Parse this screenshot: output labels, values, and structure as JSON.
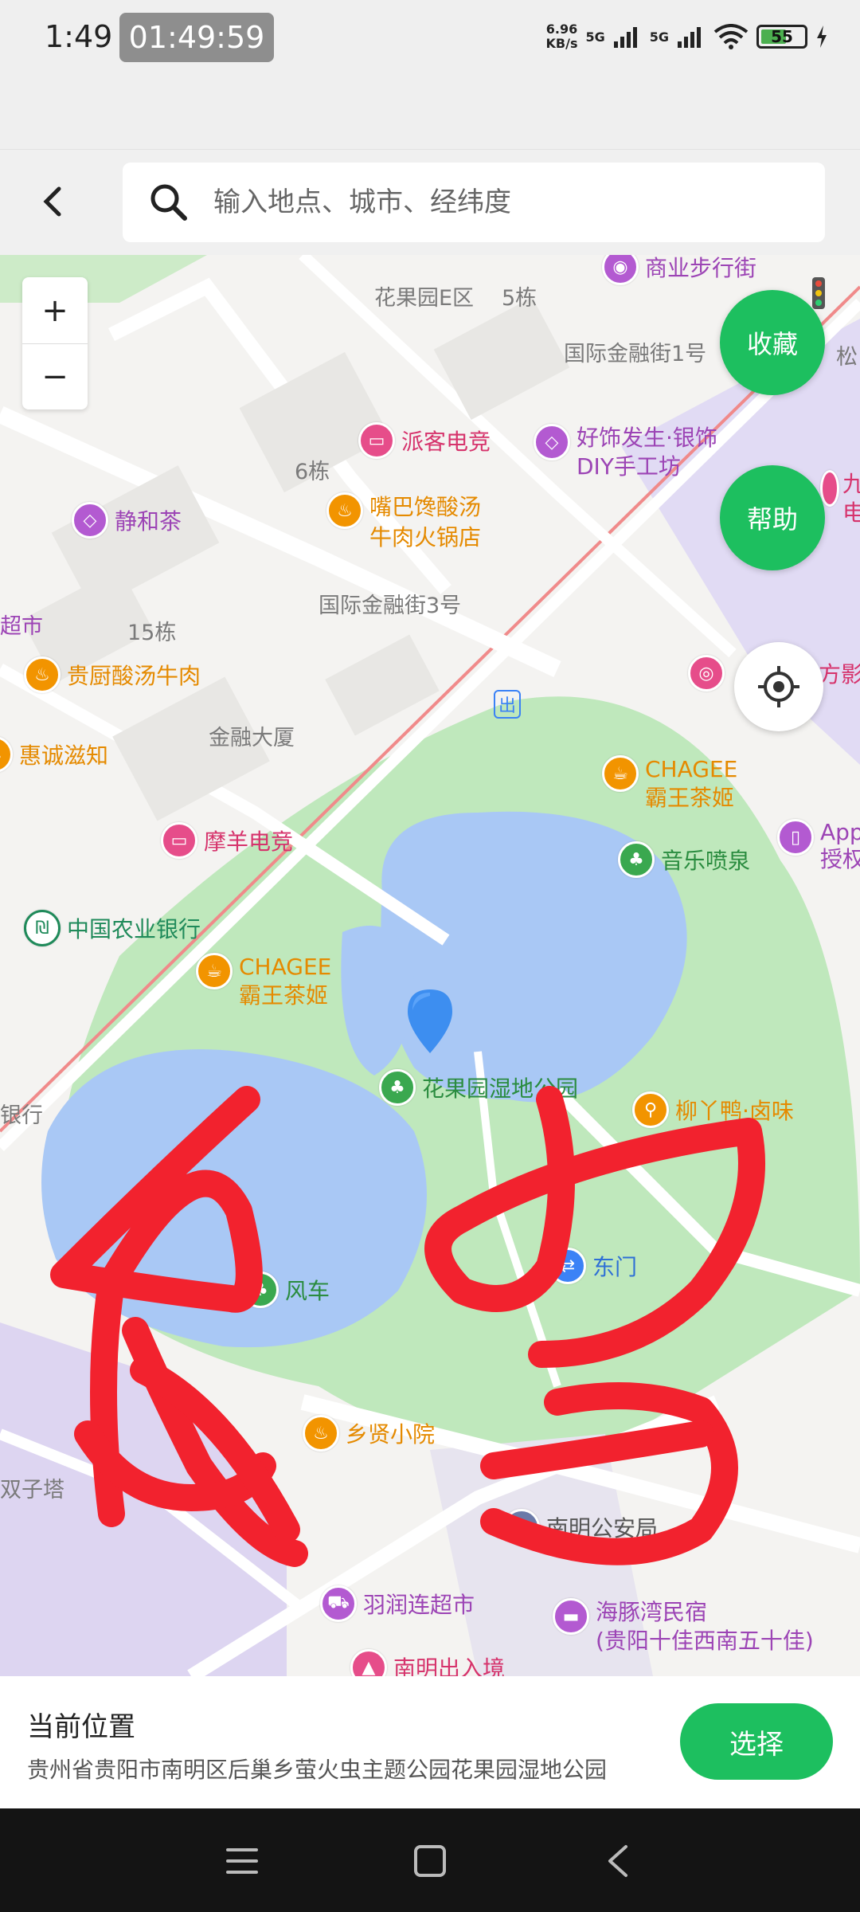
{
  "status_bar": {
    "time": "1:49",
    "timer": "01:49:59",
    "net_speed_value": "6.96",
    "net_speed_unit": "KB/s",
    "signal_1": "5G",
    "signal_2": "5G",
    "battery": "55"
  },
  "search": {
    "placeholder": "输入地点、城市、经纬度"
  },
  "map": {
    "buttons": {
      "zoom_in": "+",
      "zoom_out": "−",
      "favorite": "收藏",
      "help": "帮助"
    },
    "pois": [
      {
        "label": "商业步行街",
        "color": "purple"
      },
      {
        "label": "派客电竞",
        "color": "pink"
      },
      {
        "label": "好饰发生·银饰",
        "label2": "DIY手工坊",
        "color": "purple"
      },
      {
        "label": "静和茶",
        "color": "purple"
      },
      {
        "label": "嘴巴馋酸汤",
        "label2": "牛肉火锅店",
        "color": "orange"
      },
      {
        "label": "贵厨酸汤牛肉",
        "color": "orange"
      },
      {
        "label": "惠诚滋知",
        "color": "orange"
      },
      {
        "label": "摩羊电竞",
        "color": "pink"
      },
      {
        "label": "中国农业银行",
        "color": "bank"
      },
      {
        "label": "CHAGEE",
        "label2": "霸王茶姬",
        "color": "orange"
      },
      {
        "label": "CHAGEE",
        "label2": "霸王茶姬",
        "color": "orange"
      },
      {
        "label": "音乐喷泉",
        "color": "green"
      },
      {
        "label": "花果园湿地公园",
        "color": "green"
      },
      {
        "label": "柳丫鸭·卤味",
        "color": "orange"
      },
      {
        "label": "东门",
        "color": "blue"
      },
      {
        "label": "风车",
        "color": "green"
      },
      {
        "label": "乡贤小院",
        "color": "orange"
      },
      {
        "label": "羽润连超市",
        "color": "purple"
      },
      {
        "label": "海豚湾民宿",
        "label2": "(贵阳十佳西南五十佳)",
        "color": "purple"
      },
      {
        "label": "南明公安局",
        "color": "gray"
      },
      {
        "label": "南明出入境",
        "color": "pink"
      },
      {
        "label": "方影城",
        "color": "pink"
      },
      {
        "label": "App",
        "label2": "授权",
        "color": "purple"
      },
      {
        "label": "九",
        "label2": "电",
        "color": "pink"
      }
    ],
    "labels": {
      "area_e": "花果园E区",
      "bldg5": "5栋",
      "ifs1": "国际金融街1号",
      "song": "松",
      "bldg6": "6栋",
      "ifs3": "国际金融街3号",
      "supermarket": "超市",
      "bldg15": "15栋",
      "finance_tower": "金融大厦",
      "exit": "出",
      "bank_left": "银行",
      "twin_towers": "双子塔"
    }
  },
  "bottom_panel": {
    "title": "当前位置",
    "address": "贵州省贵阳市南明区后巢乡萤火虫主题公园花果园湿地公园",
    "select_label": "选择"
  }
}
